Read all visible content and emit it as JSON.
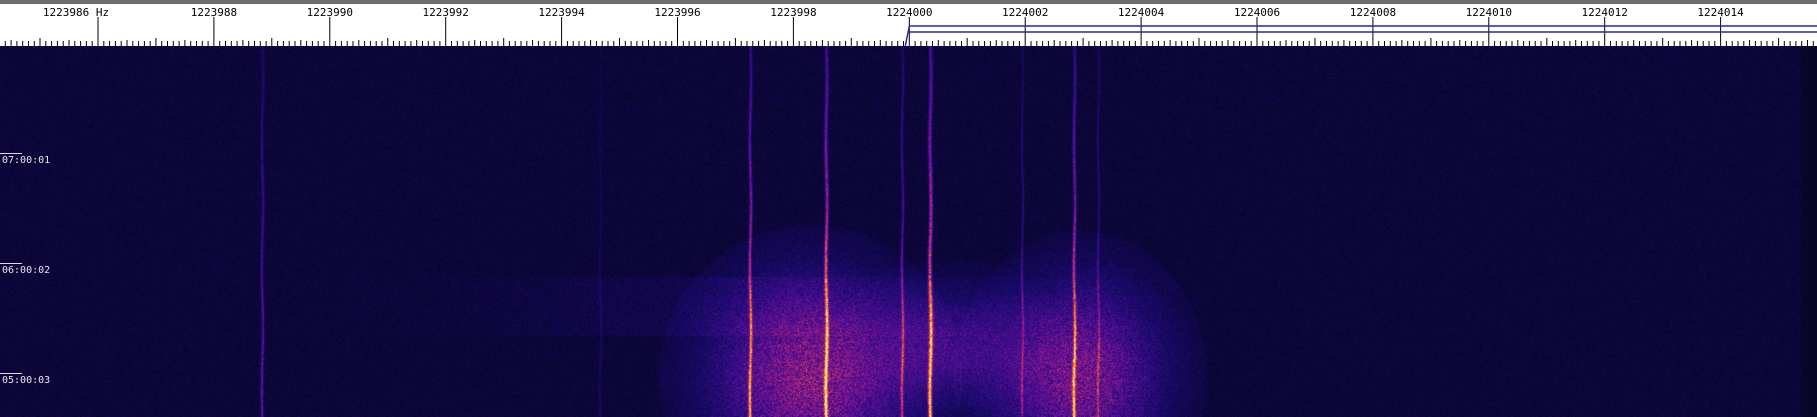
{
  "frequency_ruler": {
    "unit": "Hz",
    "labels": [
      "1223986 Hz",
      "1223988",
      "1223990",
      "1223992",
      "1223994",
      "1223996",
      "1223998",
      "1224000",
      "1224002",
      "1224004",
      "1224006",
      "1224008",
      "1224010",
      "1224012",
      "1224014"
    ],
    "tuned_marker_label": "1224000"
  },
  "time_axis": {
    "labels": [
      "07:00:01",
      "06:00:02",
      "05:00:03"
    ]
  },
  "waterfall": {
    "background_color": "#05041c",
    "palette": [
      "#05041c",
      "#1a0a6e",
      "#5a0f9a",
      "#b0207a",
      "#f07020",
      "#ffd040"
    ]
  },
  "colors": {
    "ruler_background": "#ffffff",
    "tuned_marker": "#2a2aa0",
    "top_bar": "#6e6e6e"
  }
}
